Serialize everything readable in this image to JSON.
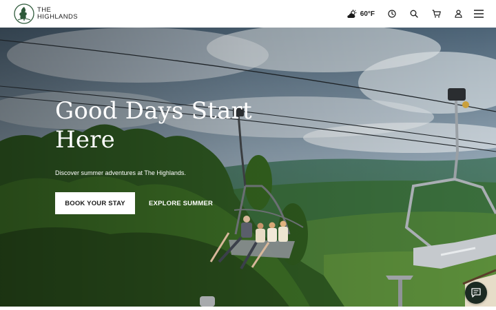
{
  "header": {
    "logo": {
      "line1": "THE",
      "line2": "HIGHLANDS",
      "icon": "tree-emblem-icon"
    },
    "weather": {
      "icon": "partly-cloudy-icon",
      "temperature": "60°F"
    },
    "icons": [
      "clock-icon",
      "search-icon",
      "cart-icon",
      "account-icon",
      "menu-icon"
    ]
  },
  "hero": {
    "title": "Good Days Start Here",
    "subtitle": "Discover summer adventures at The Highlands.",
    "primary_cta": "BOOK YOUR STAY",
    "secondary_cta": "EXPLORE SUMMER",
    "image": "chairlift-summer-photo"
  },
  "chat": {
    "icon": "chat-bubble-icon"
  },
  "colors": {
    "brand_green": "#2e5a3a",
    "header_bg": "#ffffff",
    "text_dark": "#1a1a1a",
    "chat_bg": "#1b2a22"
  }
}
